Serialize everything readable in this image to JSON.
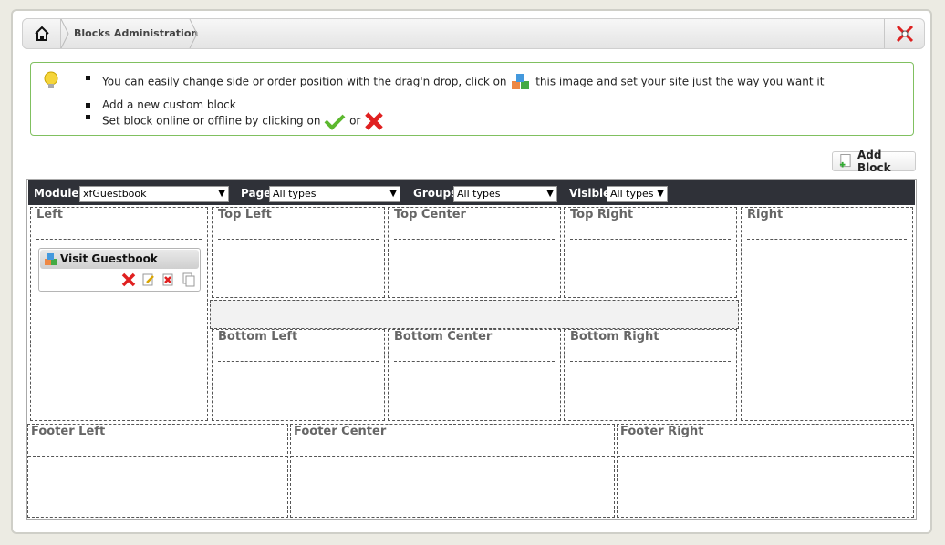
{
  "breadcrumb": {
    "title": "Blocks Administration"
  },
  "info": {
    "line1_pre": "You can easily change side or order position with the drag'n drop, click on",
    "line1_post": "this image and set your site just the way you want it",
    "line2": "Add a new custom block",
    "line3_pre": "Set block online or offline by clicking on",
    "line3_mid": "or"
  },
  "add_block_label": "Add Block",
  "filters": {
    "modules_label": "Modules",
    "modules_value": "xfGuestbook",
    "page_label": "Page",
    "page_value": "All types",
    "groups_label": "Groups",
    "groups_value": "All types",
    "visible_label": "Visible",
    "visible_value": "All types"
  },
  "zones": {
    "left": "Left",
    "top_left": "Top Left",
    "top_center": "Top Center",
    "top_right": "Top Right",
    "right": "Right",
    "bottom_left": "Bottom Left",
    "bottom_center": "Bottom Center",
    "bottom_right": "Bottom Right",
    "footer_left": "Footer Left",
    "footer_center": "Footer Center",
    "footer_right": "Footer Right"
  },
  "block": {
    "title": "Visit Guestbook"
  },
  "colors": {
    "filter_bar": "#2f3138",
    "info_border": "#80c060",
    "delete": "#e02020",
    "ok": "#5cb82e"
  }
}
